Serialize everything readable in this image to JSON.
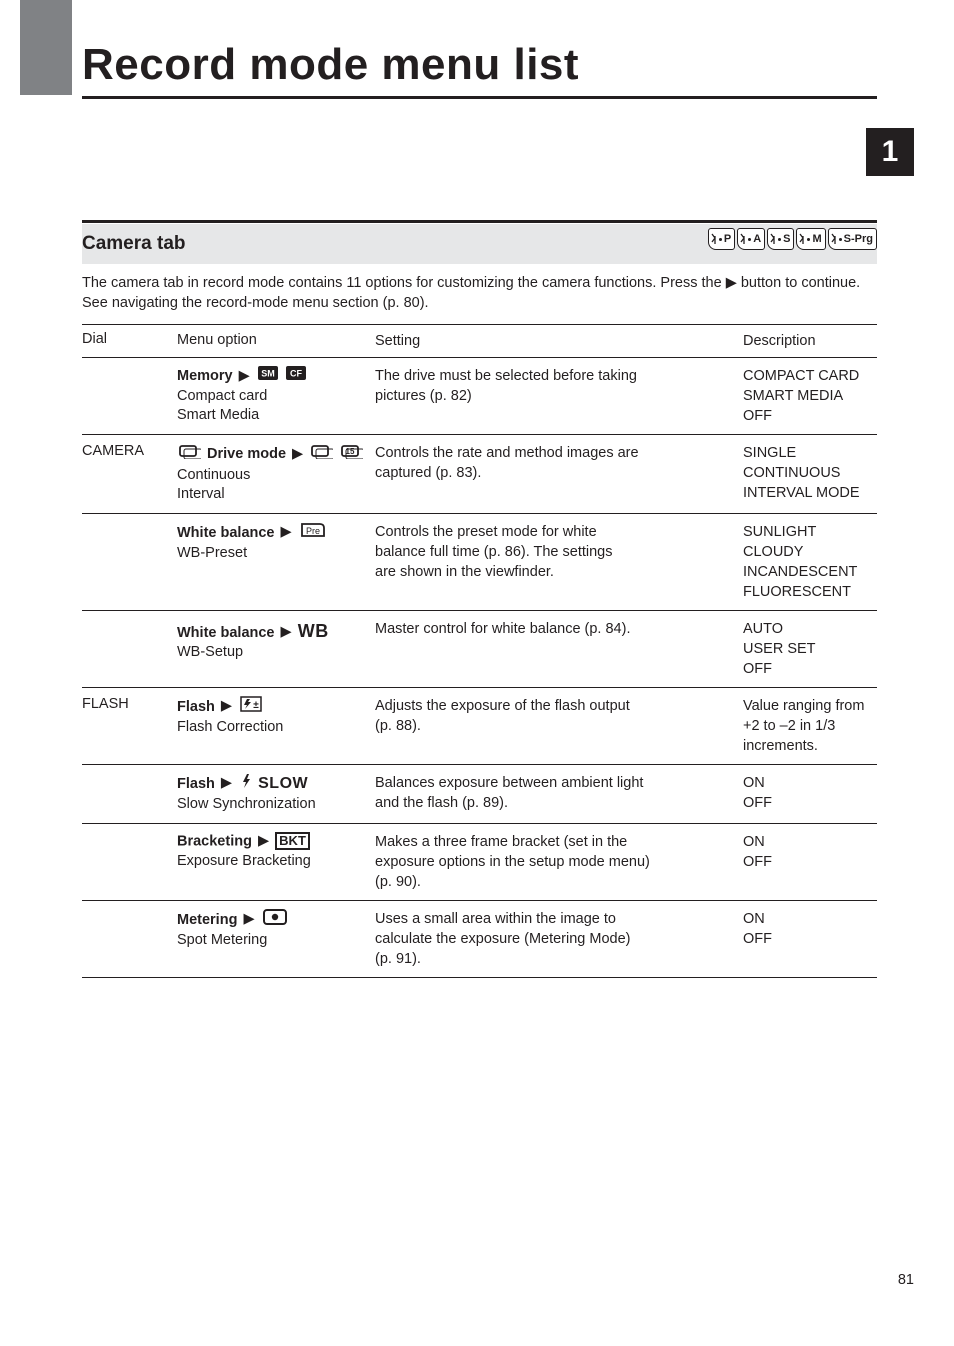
{
  "title": "Record mode menu list",
  "chapter_badge": "1",
  "subtitle": "Camera tab",
  "modes": [
    "P",
    "A",
    "S",
    "M",
    "S-Prg"
  ],
  "intro": "The camera tab in record mode contains 11 options for customizing the camera functions. Press the ▶ button to continue. See navigating the record-mode menu section (p. 80).",
  "cols": [
    "Dial",
    "Menu option",
    "Setting",
    "Description"
  ],
  "rows": [
    {
      "c1": "",
      "c2_line1": "Memory",
      "c2_line2": "Compact card\nSmart Media",
      "c3_lines": [
        "The drive must be selected before taking",
        "pictures (p. 82)"
      ],
      "c4_lines": [
        "COMPACT CARD",
        "SMART MEDIA",
        "OFF"
      ],
      "icons": "sm_cf"
    },
    {
      "c1": "CAMERA",
      "c2_line1": "Drive mode",
      "c2_line2": "Continuous\nInterval",
      "c3_lines": [
        "Controls the rate and method images are",
        "captured (p. 83)."
      ],
      "c4_lines": [
        "SINGLE",
        "CONTINUOUS",
        "INTERVAL MODE"
      ],
      "icons": "drive"
    },
    {
      "c1": "",
      "c2_line1": "White balance",
      "c2_line2": "WB-Preset",
      "c3_lines": [
        "Controls the preset mode for white",
        "balance full time (p. 86). The settings",
        "are shown in the viewfinder."
      ],
      "c4_lines": [
        "SUNLIGHT",
        "CLOUDY",
        "INCANDESCENT",
        "FLUORESCENT"
      ],
      "icons": "pre"
    },
    {
      "c1": "",
      "c2_line1": "White balance",
      "c2_line2": "WB-Setup",
      "c3_lines": [
        "Master control for white balance (p. 84)."
      ],
      "c4_lines": [
        "AUTO",
        "USER SET",
        "OFF"
      ],
      "icons": "wb"
    },
    {
      "c1": "FLASH",
      "c2_line1": "Flash",
      "c2_line2": "Flash Correction",
      "c3_lines": [
        "Adjusts the exposure of the flash output",
        "(p. 88)."
      ],
      "c4_lines": [
        "Value ranging from",
        "+2 to –2 in 1/3",
        "increments."
      ],
      "icons": "flashcorr"
    },
    {
      "c1": "",
      "c2_line1": "Flash",
      "c2_line2": "Slow Synchronization",
      "c3_lines": [
        "Balances exposure between ambient light",
        "and the flash (p. 89)."
      ],
      "c4_lines": [
        "ON",
        "OFF"
      ],
      "icons": "slow"
    },
    {
      "c1": "",
      "c2_line1": "Bracketing",
      "c2_line2": "Exposure Bracketing",
      "c3_lines": [
        "Makes a three frame bracket (set in the",
        "exposure options in the setup mode menu)",
        "(p. 90)."
      ],
      "c4_lines": [
        "ON",
        "OFF"
      ],
      "icons": "bkt"
    },
    {
      "c1": "",
      "c2_line1": "Metering",
      "c2_line2": "Spot Metering",
      "c3_lines": [
        "Uses a small area within the image to",
        "calculate the exposure (Metering Mode)",
        "(p. 91)."
      ],
      "c4_lines": [
        "ON",
        "OFF"
      ],
      "icons": "spot"
    }
  ],
  "page_number": "81"
}
